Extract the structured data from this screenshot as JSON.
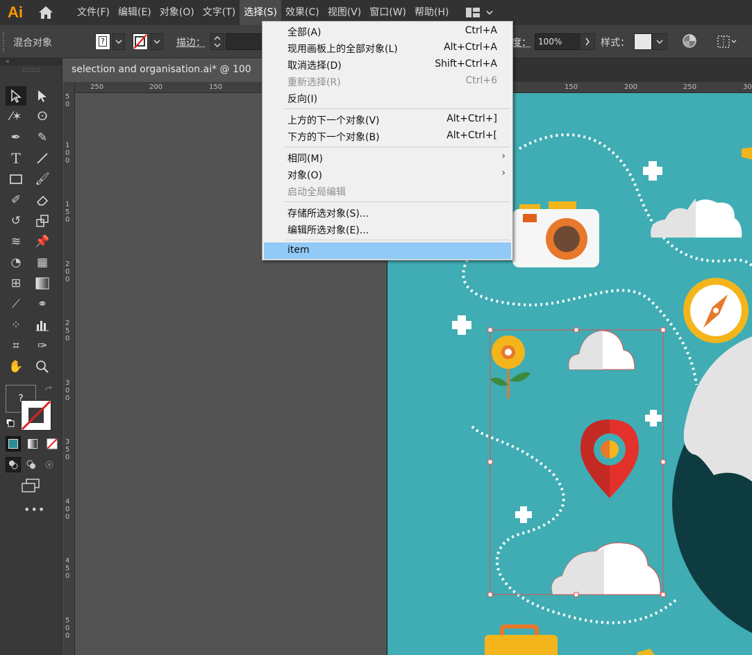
{
  "app": {
    "logo": "Ai",
    "menus": [
      "文件(F)",
      "编辑(E)",
      "对象(O)",
      "文字(T)",
      "选择(S)",
      "效果(C)",
      "视图(V)",
      "窗口(W)",
      "帮助(H)"
    ],
    "active_menu": "选择(S)"
  },
  "control_bar": {
    "selection_label": "混合对象",
    "fill_value": "?",
    "stroke_label": "描边：",
    "opacity_label": "度：",
    "opacity_value": "100%",
    "style_label": "样式："
  },
  "document": {
    "tab_title": "selection and organisation.ai* @ 100"
  },
  "rulers": {
    "horizontal": [
      "250",
      "200",
      "150",
      "150",
      "200",
      "250",
      "30"
    ],
    "vertical": [
      "50",
      "100",
      "150",
      "200",
      "250",
      "300",
      "350",
      "400",
      "450",
      "500"
    ]
  },
  "toolbar": {
    "fill_placeholder": "?",
    "more": "•••"
  },
  "select_menu": {
    "items": [
      {
        "label": "全部(A)",
        "shortcut": "Ctrl+A",
        "disabled": false
      },
      {
        "label": "现用画板上的全部对象(L)",
        "shortcut": "Alt+Ctrl+A",
        "disabled": false
      },
      {
        "label": "取消选择(D)",
        "shortcut": "Shift+Ctrl+A",
        "disabled": false
      },
      {
        "label": "重新选择(R)",
        "shortcut": "Ctrl+6",
        "disabled": true
      },
      {
        "label": "反向(I)",
        "shortcut": "",
        "disabled": false
      },
      {
        "label": "上方的下一个对象(V)",
        "shortcut": "Alt+Ctrl+]",
        "disabled": false
      },
      {
        "label": "下方的下一个对象(B)",
        "shortcut": "Alt+Ctrl+[",
        "disabled": false
      },
      {
        "label": "相同(M)",
        "shortcut": "",
        "submenu": true
      },
      {
        "label": "对象(O)",
        "shortcut": "",
        "submenu": true
      },
      {
        "label": "启动全局编辑",
        "shortcut": "",
        "disabled": true
      },
      {
        "label": "存储所选对象(S)...",
        "shortcut": "",
        "disabled": false
      },
      {
        "label": "编辑所选对象(E)...",
        "shortcut": "",
        "disabled": false
      },
      {
        "label": "item",
        "shortcut": "",
        "highlighted": true
      }
    ]
  },
  "colors": {
    "artboard": "#3fadb3",
    "accent_menu_highlight": "#91c9f7",
    "pin_red": "#e3312b",
    "flower_yellow": "#f4b51c",
    "earth_dark": "#0e3b40"
  }
}
